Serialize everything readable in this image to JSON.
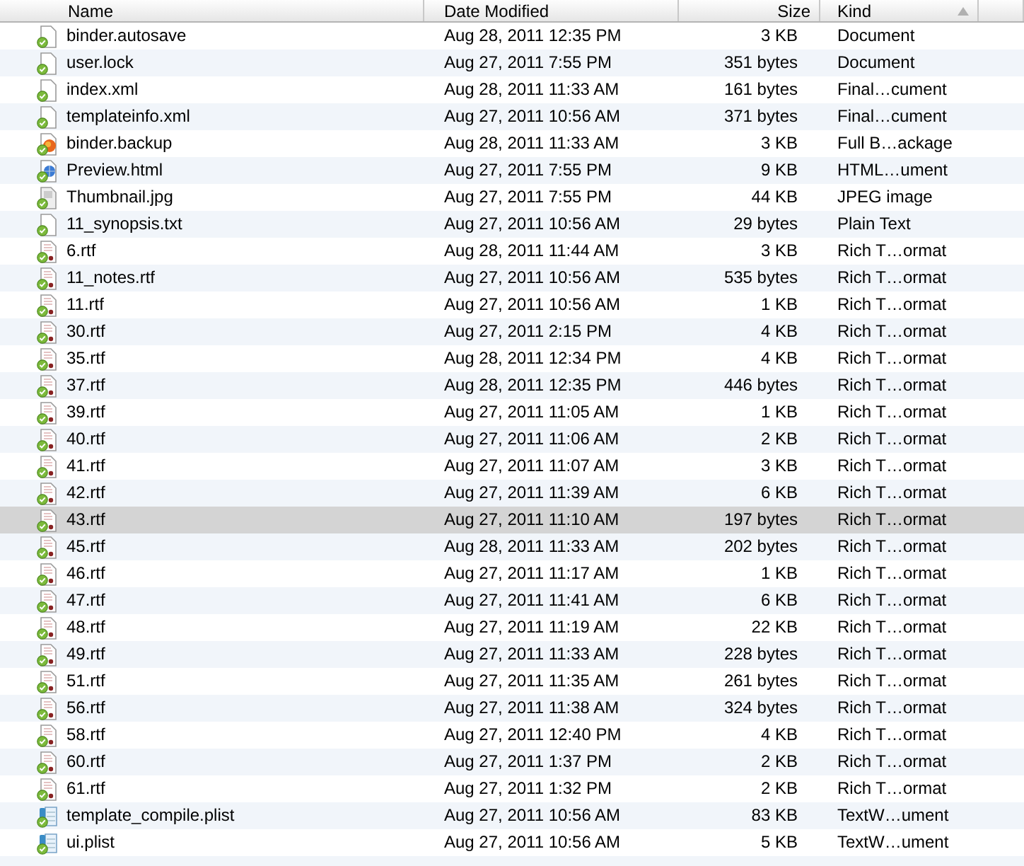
{
  "columns": [
    {
      "label": "Name",
      "sorted": false
    },
    {
      "label": "Date Modified",
      "sorted": false
    },
    {
      "label": "Size",
      "sorted": false
    },
    {
      "label": "Kind",
      "sorted": true
    }
  ],
  "rows": [
    {
      "kind": "document",
      "name": "binder.autosave",
      "date": "Aug 28, 2011 12:35 PM",
      "size": "3 KB",
      "type": "Document",
      "selected": false
    },
    {
      "kind": "document",
      "name": "user.lock",
      "date": "Aug 27, 2011 7:55 PM",
      "size": "351 bytes",
      "type": "Document",
      "selected": false
    },
    {
      "kind": "document",
      "name": "index.xml",
      "date": "Aug 28, 2011 11:33 AM",
      "size": "161 bytes",
      "type": "Final…cument",
      "selected": false
    },
    {
      "kind": "document",
      "name": "templateinfo.xml",
      "date": "Aug 27, 2011 10:56 AM",
      "size": "371 bytes",
      "type": "Final…cument",
      "selected": false
    },
    {
      "kind": "backup",
      "name": "binder.backup",
      "date": "Aug 28, 2011 11:33 AM",
      "size": "3 KB",
      "type": "Full B…ackage",
      "selected": false
    },
    {
      "kind": "html",
      "name": "Preview.html",
      "date": "Aug 27, 2011 7:55 PM",
      "size": "9 KB",
      "type": "HTML…ument",
      "selected": false
    },
    {
      "kind": "image",
      "name": "Thumbnail.jpg",
      "date": "Aug 27, 2011 7:55 PM",
      "size": "44 KB",
      "type": "JPEG image",
      "selected": false
    },
    {
      "kind": "document",
      "name": "11_synopsis.txt",
      "date": "Aug 27, 2011 10:56 AM",
      "size": "29 bytes",
      "type": "Plain Text",
      "selected": false
    },
    {
      "kind": "rtf",
      "name": "6.rtf",
      "date": "Aug 28, 2011 11:44 AM",
      "size": "3 KB",
      "type": "Rich T…ormat",
      "selected": false
    },
    {
      "kind": "rtf",
      "name": "11_notes.rtf",
      "date": "Aug 27, 2011 10:56 AM",
      "size": "535 bytes",
      "type": "Rich T…ormat",
      "selected": false
    },
    {
      "kind": "rtf",
      "name": "11.rtf",
      "date": "Aug 27, 2011 10:56 AM",
      "size": "1 KB",
      "type": "Rich T…ormat",
      "selected": false
    },
    {
      "kind": "rtf",
      "name": "30.rtf",
      "date": "Aug 27, 2011 2:15 PM",
      "size": "4 KB",
      "type": "Rich T…ormat",
      "selected": false
    },
    {
      "kind": "rtf",
      "name": "35.rtf",
      "date": "Aug 28, 2011 12:34 PM",
      "size": "4 KB",
      "type": "Rich T…ormat",
      "selected": false
    },
    {
      "kind": "rtf",
      "name": "37.rtf",
      "date": "Aug 28, 2011 12:35 PM",
      "size": "446 bytes",
      "type": "Rich T…ormat",
      "selected": false
    },
    {
      "kind": "rtf",
      "name": "39.rtf",
      "date": "Aug 27, 2011 11:05 AM",
      "size": "1 KB",
      "type": "Rich T…ormat",
      "selected": false
    },
    {
      "kind": "rtf",
      "name": "40.rtf",
      "date": "Aug 27, 2011 11:06 AM",
      "size": "2 KB",
      "type": "Rich T…ormat",
      "selected": false
    },
    {
      "kind": "rtf",
      "name": "41.rtf",
      "date": "Aug 27, 2011 11:07 AM",
      "size": "3 KB",
      "type": "Rich T…ormat",
      "selected": false
    },
    {
      "kind": "rtf",
      "name": "42.rtf",
      "date": "Aug 27, 2011 11:39 AM",
      "size": "6 KB",
      "type": "Rich T…ormat",
      "selected": false
    },
    {
      "kind": "rtf",
      "name": "43.rtf",
      "date": "Aug 27, 2011 11:10 AM",
      "size": "197 bytes",
      "type": "Rich T…ormat",
      "selected": true
    },
    {
      "kind": "rtf",
      "name": "45.rtf",
      "date": "Aug 28, 2011 11:33 AM",
      "size": "202 bytes",
      "type": "Rich T…ormat",
      "selected": false
    },
    {
      "kind": "rtf",
      "name": "46.rtf",
      "date": "Aug 27, 2011 11:17 AM",
      "size": "1 KB",
      "type": "Rich T…ormat",
      "selected": false
    },
    {
      "kind": "rtf",
      "name": "47.rtf",
      "date": "Aug 27, 2011 11:41 AM",
      "size": "6 KB",
      "type": "Rich T…ormat",
      "selected": false
    },
    {
      "kind": "rtf",
      "name": "48.rtf",
      "date": "Aug 27, 2011 11:19 AM",
      "size": "22 KB",
      "type": "Rich T…ormat",
      "selected": false
    },
    {
      "kind": "rtf",
      "name": "49.rtf",
      "date": "Aug 27, 2011 11:33 AM",
      "size": "228 bytes",
      "type": "Rich T…ormat",
      "selected": false
    },
    {
      "kind": "rtf",
      "name": "51.rtf",
      "date": "Aug 27, 2011 11:35 AM",
      "size": "261 bytes",
      "type": "Rich T…ormat",
      "selected": false
    },
    {
      "kind": "rtf",
      "name": "56.rtf",
      "date": "Aug 27, 2011 11:38 AM",
      "size": "324 bytes",
      "type": "Rich T…ormat",
      "selected": false
    },
    {
      "kind": "rtf",
      "name": "58.rtf",
      "date": "Aug 27, 2011 12:40 PM",
      "size": "4 KB",
      "type": "Rich T…ormat",
      "selected": false
    },
    {
      "kind": "rtf",
      "name": "60.rtf",
      "date": "Aug 27, 2011 1:37 PM",
      "size": "2 KB",
      "type": "Rich T…ormat",
      "selected": false
    },
    {
      "kind": "rtf",
      "name": "61.rtf",
      "date": "Aug 27, 2011 1:32 PM",
      "size": "2 KB",
      "type": "Rich T…ormat",
      "selected": false
    },
    {
      "kind": "plist",
      "name": "template_compile.plist",
      "date": "Aug 27, 2011 10:56 AM",
      "size": "83 KB",
      "type": "TextW…ument",
      "selected": false
    },
    {
      "kind": "plist",
      "name": "ui.plist",
      "date": "Aug 27, 2011 10:56 AM",
      "size": "5 KB",
      "type": "TextW…ument",
      "selected": false
    }
  ]
}
